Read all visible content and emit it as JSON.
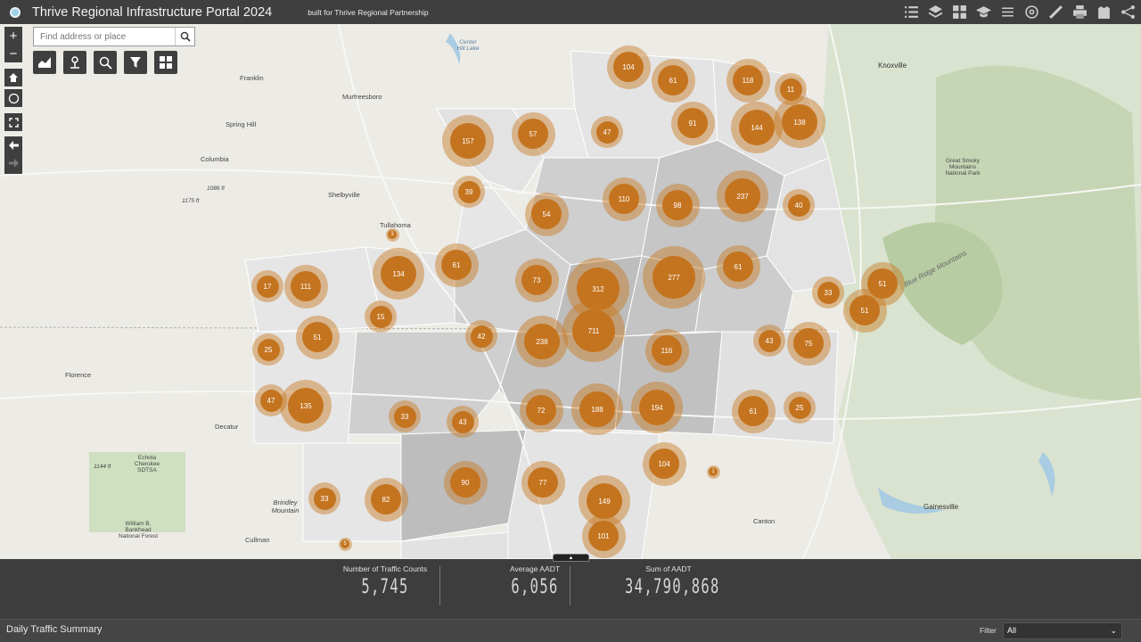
{
  "header": {
    "title": "Thrive Regional Infrastructure Portal 2024",
    "subtitle": "built for Thrive Regional Partnership"
  },
  "toolbar_icons": [
    "list-icon",
    "layers-icon",
    "basemap-gallery-icon",
    "legend-icon",
    "swap-icon",
    "analysis-icon",
    "measure-icon",
    "print-icon",
    "bookmark-icon",
    "share-icon"
  ],
  "search": {
    "placeholder": "Find address or place"
  },
  "map_tools": [
    "chart-icon",
    "location-icon",
    "query-icon",
    "filter-icon",
    "grid-icon"
  ],
  "places": {
    "knoxville": "Knoxville",
    "franklin": "Franklin",
    "murfreesboro": "Murfreesboro",
    "spring_hill": "Spring Hill",
    "columbia": "Columbia",
    "shelbyville": "Shelbyville",
    "tullahoma": "Tullahoma",
    "florence": "Florence",
    "decatur": "Decatur",
    "cullman": "Cullman",
    "canton": "Canton",
    "gainesville": "Gainesville",
    "center_hill": "Center Hill Lake",
    "smoky": "Great Smoky Mountains National Park",
    "blue_ridge": "Blue Ridge Mountains",
    "echota": "Echota Cherokee SDTSA",
    "bankhead": "William B. Bankhead National Forest",
    "brindley": "Brindley Mountain",
    "elev1": "1086 ft",
    "elev2": "1175 ft",
    "elev3": "1144 ft"
  },
  "clusters": [
    104,
    61,
    118,
    11,
    157,
    57,
    47,
    91,
    144,
    138,
    39,
    110,
    98,
    237,
    40,
    54,
    3,
    61,
    134,
    73,
    312,
    277,
    61,
    17,
    111,
    15,
    51,
    33,
    42,
    238,
    711,
    116,
    43,
    75,
    25,
    51,
    47,
    135,
    33,
    43,
    72,
    188,
    194,
    61,
    25,
    104,
    1,
    90,
    77,
    149,
    33,
    82,
    101,
    5,
    51
  ],
  "stats": {
    "count_label": "Number of Traffic Counts",
    "count_value": "5,745",
    "avg_label": "Average AADT",
    "avg_value": "6,056",
    "sum_label": "Sum of AADT",
    "sum_value": "34,790,868"
  },
  "footer": {
    "title": "Daily Traffic Summary",
    "filter_label": "Filter",
    "filter_value": "All"
  },
  "colors": {
    "cluster": "#c4741f",
    "header": "#3f3f3f"
  }
}
